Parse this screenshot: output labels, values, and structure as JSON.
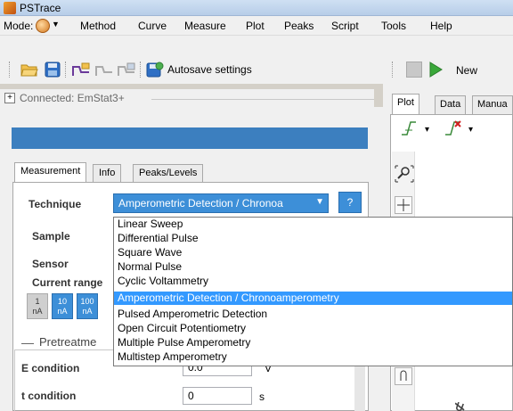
{
  "window": {
    "title": "PSTrace"
  },
  "menu": {
    "mode_label": "Mode:",
    "items": [
      "Method",
      "Curve",
      "Measure",
      "Plot",
      "Peaks",
      "Script",
      "Tools",
      "Help"
    ]
  },
  "toolbar": {
    "autosave_label": "Autosave settings",
    "new_label": "New"
  },
  "connection": {
    "status": "Connected: EmStat3+"
  },
  "left_tabs": [
    "Measurement",
    "Info",
    "Peaks/Levels"
  ],
  "form": {
    "technique_label": "Technique",
    "technique_value": "Amperometric Detection / Chronoa",
    "help_label": "?",
    "sample_label": "Sample",
    "sensor_label": "Sensor",
    "current_range_label": "Current range",
    "current_ranges": [
      {
        "line1": "1",
        "line2": "nA"
      },
      {
        "line1": "10",
        "line2": "nA"
      },
      {
        "line1": "100",
        "line2": "nA"
      }
    ],
    "pretreatment_label": "Pretreatme",
    "e_condition_label": "E condition",
    "e_condition_value": "0.0",
    "e_condition_unit": "V",
    "t_condition_label": "t condition",
    "t_condition_value": "0",
    "t_condition_unit": "s"
  },
  "technique_options": [
    "Linear Sweep",
    "Differential Pulse",
    "Square Wave",
    "Normal Pulse",
    "Cyclic Voltammetry",
    "Amperometric Detection / Chronoamperometry",
    "Pulsed Amperometric Detection",
    "Open Circuit Potentiometry",
    "Multiple Pulse Amperometry",
    "Multistep Amperometry"
  ],
  "selected_option_index": 5,
  "right_tabs": [
    "Plot",
    "Data",
    "Manua"
  ],
  "colors": {
    "accent": "#3d8fd8",
    "header_bar": "#3c7fbf",
    "selection": "#3399ff"
  }
}
